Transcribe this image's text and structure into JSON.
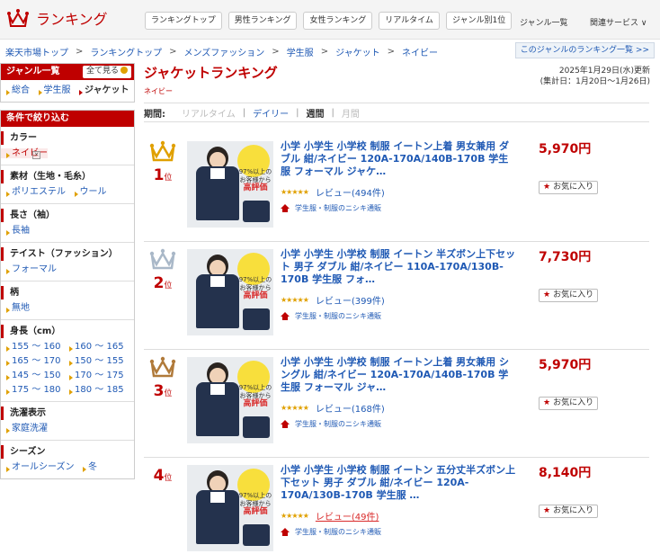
{
  "header": {
    "logo_text": "ランキング",
    "tabs": [
      "ランキングトップ",
      "男性ランキング",
      "女性ランキング",
      "リアルタイム",
      "ジャンル別1位"
    ],
    "genre_list_link": "ジャンル一覧",
    "related_services": "関連サービス ∨"
  },
  "breadcrumb": [
    "楽天市場トップ",
    "ランキングトップ",
    "メンズファッション",
    "学生服",
    "ジャケット",
    "ネイビー"
  ],
  "genre_ranking_button": "このジャンルのランキング一覧 >>",
  "sidebar": {
    "genre_title": "ジャンル一覧",
    "see_all": "全て見る",
    "genres": [
      {
        "label": "総合",
        "current": false
      },
      {
        "label": "学生服",
        "current": false
      },
      {
        "label": "ジャケット",
        "current": true
      }
    ],
    "filter_title": "条件で絞り込む",
    "filters": [
      {
        "title": "カラー",
        "items": [
          "ネイビー"
        ],
        "selected": 0
      },
      {
        "title": "素材（生地・毛糸）",
        "items": [
          "ポリエステル",
          "ウール"
        ]
      },
      {
        "title": "長さ（袖）",
        "items": [
          "長袖"
        ]
      },
      {
        "title": "テイスト（ファッション）",
        "items": [
          "フォーマル"
        ]
      },
      {
        "title": "柄",
        "items": [
          "無地"
        ]
      },
      {
        "title": "身長（cm）",
        "items": [
          "155 ～ 160",
          "160 ～ 165",
          "165 ～ 170",
          "150 ～ 155",
          "145 ～ 150",
          "170 ～ 175",
          "175 ～ 180",
          "180 ～ 185"
        ]
      },
      {
        "title": "洗濯表示",
        "items": [
          "家庭洗濯"
        ]
      },
      {
        "title": "シーズン",
        "items": [
          "オールシーズン",
          "冬"
        ]
      }
    ]
  },
  "main": {
    "title": "ジャケットランキング",
    "subtitle": "ネイビー",
    "updated": "2025年1月29日(水)更新",
    "period_range": "(集計日：1月20日～1月26日)",
    "period_label": "期間:",
    "periods": [
      {
        "label": "リアルタイム",
        "state": "disabled"
      },
      {
        "label": "デイリー",
        "state": "link"
      },
      {
        "label": "週間",
        "state": "active"
      },
      {
        "label": "月間",
        "state": "disabled"
      }
    ]
  },
  "items": [
    {
      "rank": "1",
      "rank_unit": "位",
      "crown": "gold",
      "title": "小学 小学生 小学校 制服 イートン上着 男女兼用 ダブル 紺/ネイビー 120A-170A/140B-170B 学生服 フォーマル ジャケ…",
      "price": "5,970円",
      "review": "レビュー(494件)",
      "stars": "★★★★★",
      "shop": "学生服・制服のニシキ通販",
      "fav": "お気に入り",
      "badge_top": "97%以上の",
      "badge_mid": "お客様から",
      "badge_hi": "高評価"
    },
    {
      "rank": "2",
      "rank_unit": "位",
      "crown": "silver",
      "title": "小学 小学生 小学校 制服 イートン 半ズボン上下セット 男子 ダブル 紺/ネイビー 110A-170A/130B-170B 学生服 フォ…",
      "price": "7,730円",
      "review": "レビュー(399件)",
      "stars": "★★★★★",
      "shop": "学生服・制服のニシキ通販",
      "fav": "お気に入り",
      "badge_top": "97%以上の",
      "badge_mid": "お客様から",
      "badge_hi": "高評価"
    },
    {
      "rank": "3",
      "rank_unit": "位",
      "crown": "bronze",
      "title": "小学 小学生 小学校 制服 イートン上着 男女兼用 シングル 紺/ネイビー 120A-170A/140B-170B 学生服 フォーマル ジャ…",
      "price": "5,970円",
      "review": "レビュー(168件)",
      "stars": "★★★★★",
      "shop": "学生服・制服のニシキ通販",
      "fav": "お気に入り",
      "badge_top": "97%以上の",
      "badge_mid": "お客様から",
      "badge_hi": "高評価"
    },
    {
      "rank": "4",
      "rank_unit": "位",
      "crown": "none",
      "title": "小学 小学生 小学校 制服 イートン 五分丈半ズボン上下セット 男子 ダブル 紺/ネイビー 120A-170A/130B-170B 学生服 …",
      "price": "8,140円",
      "review": "レビュー(49件)",
      "stars": "★★★★★",
      "shop": "学生服・制服のニシキ通販",
      "fav": "お気に入り",
      "badge_top": "97%以上の",
      "badge_mid": "お客様から",
      "badge_hi": "高評価"
    }
  ],
  "colors": {
    "accent": "#bf0000",
    "link": "#1f59b4",
    "gold": "#e0a000",
    "silver": "#a9b8c8",
    "bronze": "#b07a3a"
  }
}
